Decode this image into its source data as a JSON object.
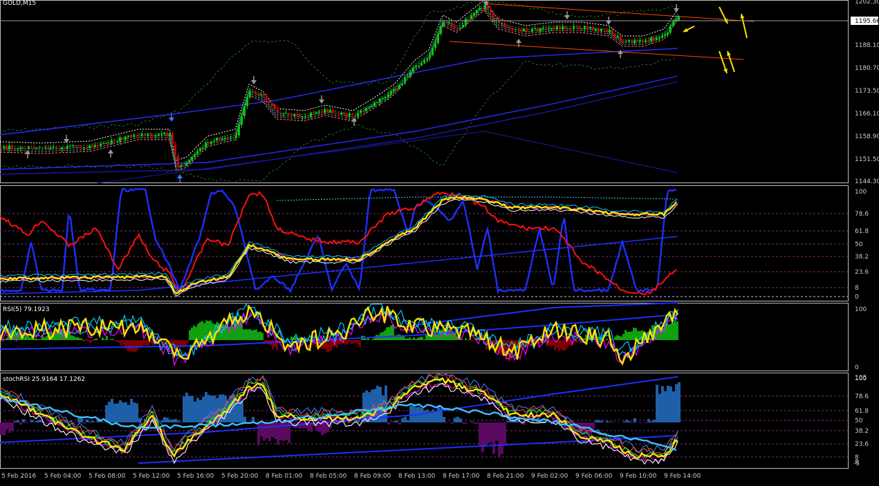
{
  "window": {
    "symbol_label": "GOLD,M15",
    "current_price": "1195.66"
  },
  "panes": {
    "main": {
      "price_labels": [
        "1202.30",
        "1195.66",
        "1188.10",
        "1180.70",
        "1173.50",
        "1166.10",
        "1158.90",
        "1151.50",
        "1144.30"
      ]
    },
    "stoch": {
      "level_labels": [
        "100",
        "78.6",
        "61.8",
        "50",
        "38.2",
        "23.6",
        "8",
        "0"
      ]
    },
    "rsi": {
      "label": "RSI(5) 79.1923",
      "level_labels": [
        "100",
        "0"
      ]
    },
    "stochrsi": {
      "label": "stochRSI 25.9164 17.1262",
      "level_labels": [
        "105",
        "100",
        "78.6",
        "61.8",
        "50",
        "38.2",
        "23.6",
        "8",
        "0",
        "-5"
      ]
    }
  },
  "time_axis": {
    "labels": [
      "5 Feb 2016",
      "5 Feb 04:00",
      "5 Feb 08:00",
      "5 Feb 12:00",
      "5 Feb 16:00",
      "5 Feb 20:00",
      "8 Feb 01:00",
      "8 Feb 05:00",
      "8 Feb 09:00",
      "8 Feb 13:00",
      "8 Feb 17:00",
      "8 Feb 21:00",
      "9 Feb 02:00",
      "9 Feb 06:00",
      "9 Feb 10:00",
      "9 Feb 14:00"
    ]
  },
  "colors": {
    "background": "#000000",
    "bull_candle": "#00cc00",
    "bear_candle": "#cc0000",
    "stoch_blue": "#1f2fff",
    "stoch_red": "#ff1010",
    "yellow_line": "#ffe100",
    "channel_line": "#ff4500",
    "arrow_yellow": "#ffe000"
  },
  "icons": [
    "arrow-down-icon",
    "arrow-up-icon",
    "fractal-arrow-icon"
  ]
}
